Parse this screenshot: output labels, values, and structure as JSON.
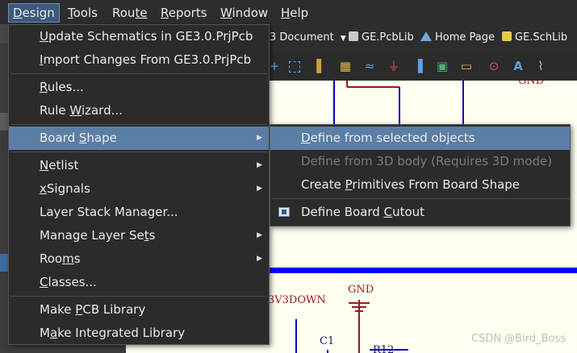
{
  "menubar": {
    "items": [
      {
        "label": "Design",
        "key": "D",
        "rest": "esign",
        "active": true
      },
      {
        "label": "Tools",
        "key": "T",
        "rest": "ools"
      },
      {
        "label": "Route",
        "key": "Rou",
        "rest": "te"
      },
      {
        "label": "Reports",
        "key": "R",
        "rest": "eports"
      },
      {
        "label": "Window",
        "key": "W",
        "rest": "indow"
      },
      {
        "label": "Help",
        "key": "H",
        "rest": "elp"
      }
    ]
  },
  "tabs": [
    {
      "label": "3 Document",
      "icon": "dropdown-icon"
    },
    {
      "label": "GE.PcbLib",
      "icon": "pcblib-icon"
    },
    {
      "label": "Home Page",
      "icon": "home-icon"
    },
    {
      "label": "GE.SchLib",
      "icon": "schlib-icon"
    }
  ],
  "design_menu": {
    "items": [
      {
        "pre": "",
        "key": "U",
        "post": "pdate Schematics in GE3.0.PrjPcb"
      },
      {
        "pre": "",
        "key": "I",
        "post": "mport Changes From GE3.0.PrjPcb"
      },
      {
        "pre": "",
        "key": "R",
        "post": "ules..."
      },
      {
        "pre": "Rule ",
        "key": "W",
        "post": "izard..."
      },
      {
        "pre": "Board ",
        "key": "S",
        "post": "hape",
        "submenu": true,
        "highlighted": true
      },
      {
        "pre": "",
        "key": "N",
        "post": "etlist",
        "submenu": true
      },
      {
        "pre": "",
        "key": "x",
        "post": "Signals",
        "submenu": true
      },
      {
        "pre": "Layer Stack Manager...",
        "key": "",
        "post": ""
      },
      {
        "pre": "Manage Layer Se",
        "key": "t",
        "post": "s",
        "submenu": true
      },
      {
        "pre": "Roo",
        "key": "m",
        "post": "s",
        "submenu": true
      },
      {
        "pre": "",
        "key": "C",
        "post": "lasses..."
      },
      {
        "pre": "Make ",
        "key": "P",
        "post": "CB Library"
      },
      {
        "pre": "M",
        "key": "a",
        "post": "ke Integrated Library"
      }
    ]
  },
  "board_shape_submenu": {
    "items": [
      {
        "pre": "",
        "key": "D",
        "post": "efine from selected objects",
        "highlighted": true
      },
      {
        "pre": "Define from 3D body (Requires 3D mode)",
        "key": "",
        "post": "",
        "disabled": true
      },
      {
        "pre": "Create ",
        "key": "P",
        "post": "rimitives From Board Shape"
      },
      {
        "pre": "Define Board ",
        "key": "C",
        "post": "utout",
        "icon": "board-cutout-icon"
      }
    ]
  },
  "schematic": {
    "gnd_top": "GND",
    "gnd_bottom": "GND",
    "net_label": "3V3DOWN",
    "c1": "C1",
    "r12": "R12"
  },
  "watermark": "CSDN @Bird_Boss",
  "colors": {
    "menu_bg": "#2b2b2b",
    "highlight": "#5b7ea6",
    "canvas_bg": "#fffef0",
    "wire_blue": "#0000c8",
    "component_red": "#9b1a1a"
  }
}
